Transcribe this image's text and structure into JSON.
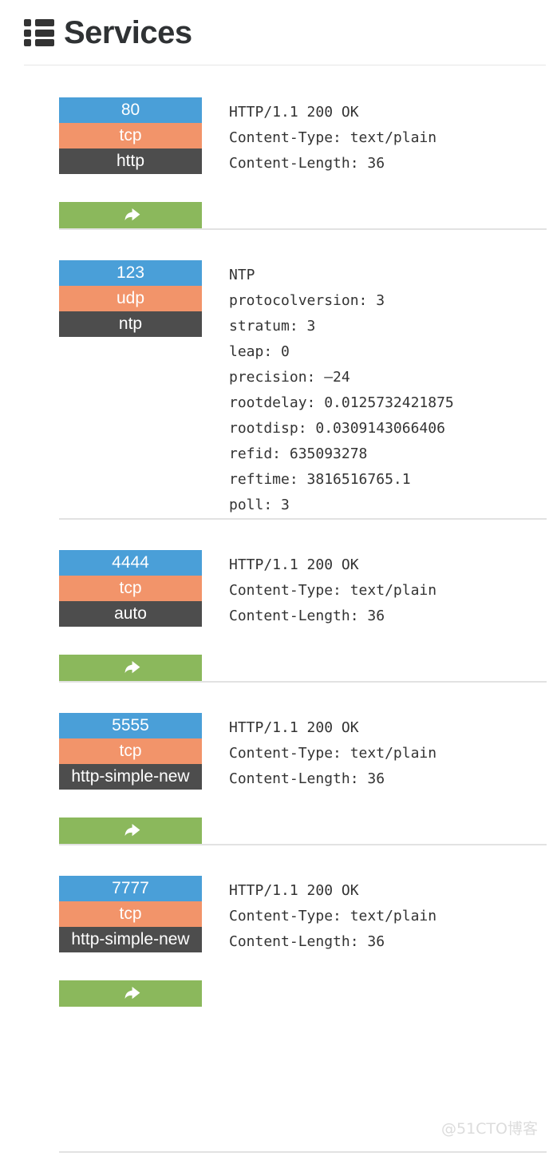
{
  "header": {
    "title": "Services",
    "icon": "list-icon"
  },
  "action": {
    "icon": "share-arrow-icon",
    "label": ""
  },
  "services": [
    {
      "port": "80",
      "protocol": "tcp",
      "name": "http",
      "has_action": true,
      "details": "HTTP/1.1 200 OK\nContent-Type: text/plain\nContent-Length: 36"
    },
    {
      "port": "123",
      "protocol": "udp",
      "name": "ntp",
      "has_action": false,
      "details": "NTP\nprotocolversion: 3\nstratum: 3\nleap: 0\nprecision: –24\nrootdelay: 0.0125732421875\nrootdisp: 0.0309143066406\nrefid: 635093278\nreftime: 3816516765.1\npoll: 3"
    },
    {
      "port": "4444",
      "protocol": "tcp",
      "name": "auto",
      "has_action": true,
      "details": "HTTP/1.1 200 OK\nContent-Type: text/plain\nContent-Length: 36"
    },
    {
      "port": "5555",
      "protocol": "tcp",
      "name": "http-simple-new",
      "has_action": true,
      "details": "HTTP/1.1 200 OK\nContent-Type: text/plain\nContent-Length: 36"
    },
    {
      "port": "7777",
      "protocol": "tcp",
      "name": "http-simple-new",
      "has_action": true,
      "details": "HTTP/1.1 200 OK\nContent-Type: text/plain\nContent-Length: 36"
    }
  ],
  "watermark": "@51CTO博客",
  "colors": {
    "port": "#4a9fd8",
    "protocol": "#f2946a",
    "name": "#4d4d4d",
    "action": "#8bb85c",
    "divider": "#e2e2e2",
    "title": "#2f3234"
  }
}
